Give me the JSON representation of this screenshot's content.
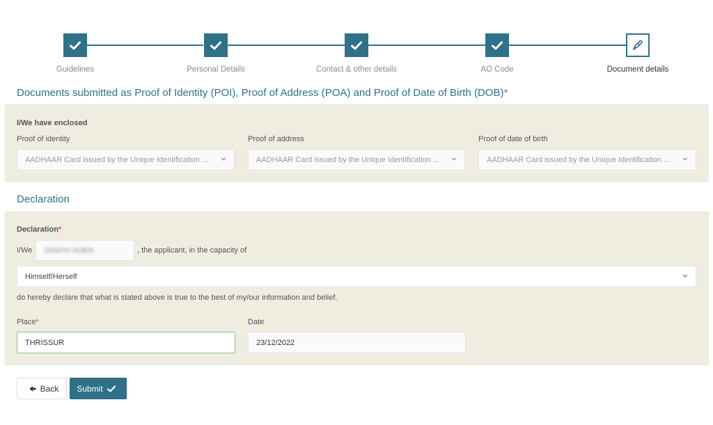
{
  "stepper": {
    "steps": [
      {
        "label": "Guidelines",
        "status": "completed",
        "icon": "check-icon"
      },
      {
        "label": "Personal Details",
        "status": "completed",
        "icon": "check-icon"
      },
      {
        "label": "Contact & other details",
        "status": "completed",
        "icon": "check-icon"
      },
      {
        "label": "AO Code",
        "status": "completed",
        "icon": "check-icon"
      },
      {
        "label": "Document details",
        "status": "current",
        "icon": "pencil-icon"
      }
    ]
  },
  "documents": {
    "title": "Documents submitted as Proof of Identity (POI), Proof of Address (POA) and Proof of Date of Birth (DOB)",
    "required_mark": "*",
    "enclosed_label": "I/We have enclosed",
    "fields": [
      {
        "label": "Proof of identity",
        "value": "AADHAAR Card issued by the Unique Identification ..."
      },
      {
        "label": "Proof of address",
        "value": "AADHAAR Card issued by the Unique Identification ..."
      },
      {
        "label": "Proof of date of birth",
        "value": "AADHAAR Card issued by the Unique Identification ..."
      }
    ]
  },
  "declaration": {
    "title": "Declaration",
    "field_label": "Declaration",
    "required_mark": "*",
    "prefix": "I/We",
    "name_value": "JONATH SUBIN",
    "suffix": ", the applicant, in the capacity of",
    "capacity_value": "Himself/Herself",
    "statement": "do hereby declare that what is stated above is true to the best of my/our information and belief.",
    "place_label": "Place",
    "place_required_mark": "*",
    "place_value": "THRISSUR",
    "date_label": "Date",
    "date_value": "23/12/2022"
  },
  "actions": {
    "back_label": "Back",
    "submit_label": "Submit"
  },
  "colors": {
    "accent": "#2f7189",
    "panel_bg": "#efece0",
    "required": "#d9534f"
  }
}
